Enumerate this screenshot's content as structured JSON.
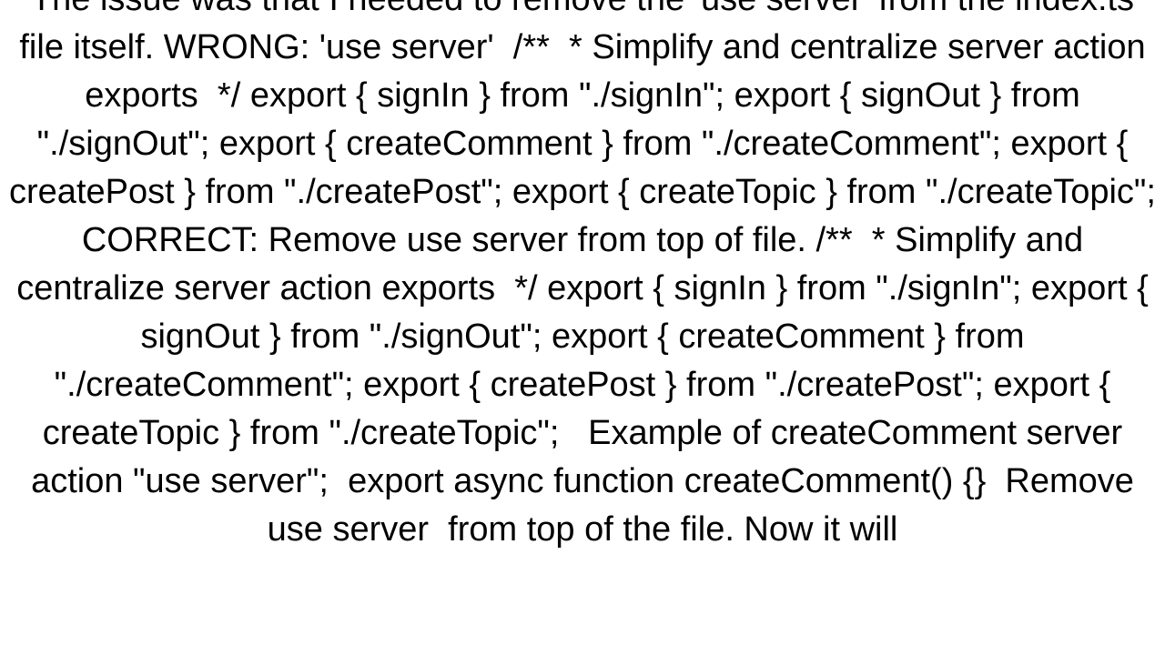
{
  "document": {
    "background_color": "#ffffff",
    "text_color": "#000000",
    "alignment": "center",
    "clipped_top": true,
    "clipped_bottom": true,
    "body_text": "The issue was that I needed to remove the 'use server' from the index.ts file itself. WRONG: 'use server'  /**  * Simplify and centralize server action exports  */ export { signIn } from \"./signIn\"; export { signOut } from \"./signOut\"; export { createComment } from \"./createComment\"; export { createPost } from \"./createPost\"; export { createTopic } from \"./createTopic\"; CORRECT: Remove use server from top of file. /**  * Simplify and centralize server action exports  */ export { signIn } from \"./signIn\"; export { signOut } from \"./signOut\"; export { createComment } from \"./createComment\"; export { createPost } from \"./createPost\"; export { createTopic } from \"./createTopic\";   Example of createComment server action \"use server\";  export async function createComment() {}  Remove use server  from top of the file. Now it will",
    "lines": [
      "The issue was that I needed to remove the 'use server' from",
      "the index.ts file itself. WRONG: 'use server'  /**  *",
      "Simplify and centralize server action exports  */ export {",
      "signIn } from \"./signIn\"; export { signOut } from",
      "\"./signOut\"; export { createComment } from",
      "\"./createComment\"; export { createPost } from",
      "\"./createPost\"; export { createTopic } from \"./createTopic\";",
      "CORRECT: Remove use server from top of file. /**  * Simplify",
      "and centralize server action exports  */ export { signIn }",
      "from \"./signIn\"; export { signOut } from \"./signOut\"; export",
      "{ createComment } from \"./createComment\"; export {",
      "createPost } from \"./createPost\"; export { createTopic }",
      "from \"./createTopic\";   Example of createComment server",
      "action \"use server\";  export async function createComment()",
      "{}  Remove use server  from top of the file. Now it will"
    ]
  }
}
